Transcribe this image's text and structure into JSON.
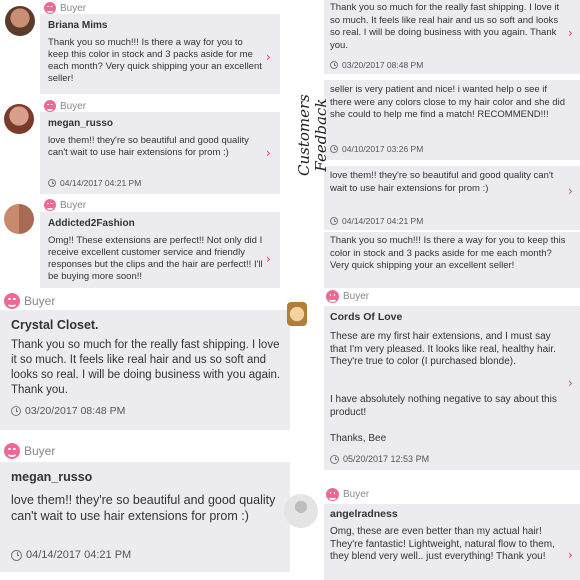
{
  "app": {
    "side_label_line1": "Customers",
    "side_label_line2": "Feedback"
  },
  "buyer_label": "Buyer",
  "reviews": [
    {
      "name": "Briana Mims",
      "text": "Thank you so much!!! Is there a way  for you to keep this color in stock and 3 packs aside for me each month? Very quick shipping your an excellent seller!",
      "date": ""
    },
    {
      "name": "megan_russo",
      "text": "love them!! they're so beautiful and good quality can't wait to use hair extensions for prom :)",
      "date": "04/14/2017 04:21 PM"
    },
    {
      "name": "Addicted2Fashion",
      "text": "Omg!! These extensions are perfect!! Not only did I receive excellent customer service and friendly responses but the clips and the hair are perfect!! I'll be buying more soon!!",
      "date": ""
    },
    {
      "name": "",
      "text": "Thank you so much for the really fast shipping. I love it so much. It feels like real hair and us so soft and looks so real. I will be doing business with you again. Thank you.",
      "date": "03/20/2017 08:48 PM"
    },
    {
      "name": "",
      "text": "seller is very patient and nice! i wanted help o see if there were any colors close to my hair color and she did she could to help me find a match! RECOMMEND!!!",
      "date": "04/10/2017 03:26 PM"
    },
    {
      "name": "",
      "text": "love them!! they're so beautiful and good quality can't wait to use hair extensions for prom :)",
      "date": "04/14/2017 04:21 PM"
    },
    {
      "name": "",
      "text": "Thank you so much!!! Is there a way  for you to keep this color in stock and 3 packs aside for me each month? Very quick shipping your an excellent seller!",
      "date": ""
    },
    {
      "name": "Crystal Closet.",
      "text": "Thank you so much for the really fast shipping. I love it so much. It feels like real hair and us so soft and looks so real. I will be doing business with you again. Thank you.",
      "date": "03/20/2017 08:48 PM"
    },
    {
      "name": "megan_russo",
      "text": "love them!! they're so beautiful and good quality can't wait to use hair extensions for prom :)",
      "date": "04/14/2017 04:21 PM"
    },
    {
      "name": "Cords Of Love",
      "text": "These are my first hair extensions, and I must say that I'm very pleased. It looks like real, healthy hair. They're true to color (I purchased blonde).",
      "text2": "I have absolutely nothing negative to say about this product!",
      "text3": "Thanks, Bee",
      "date": "05/20/2017 12:53 PM"
    },
    {
      "name": "angelradness",
      "text": "Omg, these are even better than my actual hair! They're fantastic! Lightweight, natural flow to them, they blend very well.. just everything! Thank you!",
      "date": ""
    }
  ],
  "colors": {
    "card_bg": "#ecebf0",
    "accent": "#e2385f",
    "buyer_icon": "#ec6a92"
  },
  "icons": {
    "chevron": "chevron-right-icon",
    "clock": "clock-icon",
    "buyer": "smiley-icon"
  }
}
